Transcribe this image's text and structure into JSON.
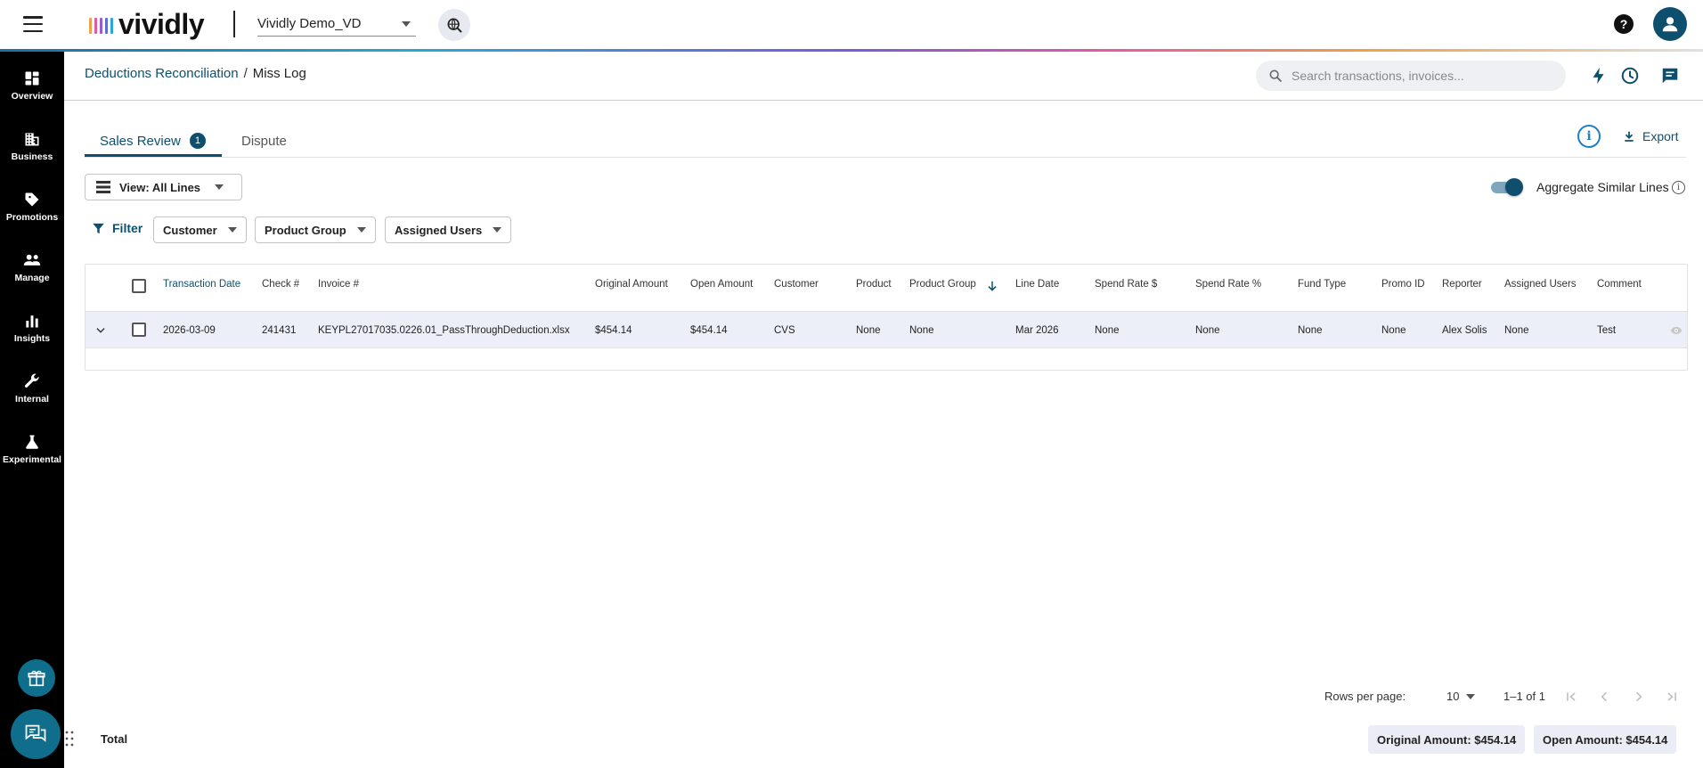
{
  "topbar": {
    "logo_text": "vividly",
    "org_name": "Vividly Demo_VD",
    "help_label": "?"
  },
  "sidebar": {
    "items": [
      {
        "label": "Overview",
        "icon": "dashboard-icon"
      },
      {
        "label": "Business",
        "icon": "building-icon"
      },
      {
        "label": "Promotions",
        "icon": "tag-icon"
      },
      {
        "label": "Manage",
        "icon": "people-icon"
      },
      {
        "label": "Insights",
        "icon": "bar-chart-icon"
      },
      {
        "label": "Internal",
        "icon": "wrench-icon"
      },
      {
        "label": "Experimental",
        "icon": "flask-icon"
      }
    ]
  },
  "header": {
    "breadcrumb_parent": "Deductions Reconciliation",
    "breadcrumb_sep": "/",
    "breadcrumb_current": "Miss Log",
    "search_placeholder": "Search transactions, invoices..."
  },
  "tabs": [
    {
      "label": "Sales Review",
      "badge": "1",
      "active": true
    },
    {
      "label": "Dispute",
      "active": false
    }
  ],
  "toolbar": {
    "export_label": "Export",
    "info_label": "i",
    "view_label": "View: All Lines",
    "aggregate_label": "Aggregate Similar Lines",
    "aggregate_on": true,
    "filter_label": "Filter",
    "filter_chips": [
      "Customer",
      "Product Group",
      "Assigned Users"
    ]
  },
  "table": {
    "columns": [
      "Transaction Date",
      "Check #",
      "Invoice #",
      "Original Amount",
      "Open Amount",
      "Customer",
      "Product",
      "Product Group",
      "Line Date",
      "Spend Rate $",
      "Spend Rate %",
      "Fund Type",
      "Promo ID",
      "Reporter",
      "Assigned Users",
      "Comment"
    ],
    "rows": [
      [
        "2026-03-09",
        "241431",
        "KEYPL27017035.0226.01_PassThroughDeduction.xlsx",
        "$454.14",
        "$454.14",
        "CVS",
        "None",
        "None",
        "Mar 2026",
        "None",
        "None",
        "None",
        "None",
        "Alex Solis",
        "None",
        "Test"
      ]
    ]
  },
  "pagination": {
    "rows_per_page_label": "Rows per page:",
    "rows_per_page": "10",
    "range": "1–1 of 1"
  },
  "footer": {
    "total_label": "Total",
    "original_amount": "Original Amount: $454.14",
    "open_amount": "Open Amount: $454.14"
  },
  "colors": {
    "brand": "#0e4f6e",
    "sidebar_bg": "#000000",
    "row_highlight": "#eceef8",
    "link_blue": "#1f7fc4"
  }
}
